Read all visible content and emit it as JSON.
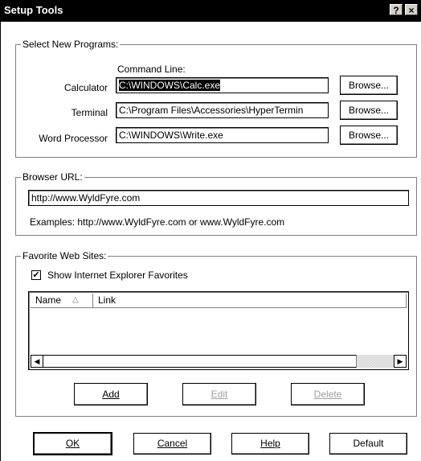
{
  "window": {
    "title": "Setup Tools",
    "help_button": "?",
    "close_button": "×"
  },
  "programs": {
    "group_label": "Select New Programs:",
    "column_header": "Command Line:",
    "rows": [
      {
        "label": "Calculator",
        "value": "C:\\WINDOWS\\Calc.exe",
        "button": "Browse..."
      },
      {
        "label": "Terminal",
        "value": "C:\\Program Files\\Accessories\\HyperTermin",
        "button": "Browse..."
      },
      {
        "label": "Word Processor",
        "value": "C:\\WINDOWS\\Write.exe",
        "button": "Browse..."
      }
    ]
  },
  "browser": {
    "group_label": "Browser URL:",
    "url": "http://www.WyldFyre.com",
    "examples": "Examples: http://www.WyldFyre.com or www.WyldFyre.com"
  },
  "favorites": {
    "group_label": "Favorite Web Sites:",
    "checkbox_label": "Show Internet Explorer Favorites",
    "checked": true,
    "columns": [
      "Name",
      "Link"
    ],
    "buttons": {
      "add": "Add",
      "edit": "Edit",
      "delete": "Delete"
    }
  },
  "footer": {
    "ok": "OK",
    "cancel": "Cancel",
    "help": "Help",
    "default": "Default"
  }
}
